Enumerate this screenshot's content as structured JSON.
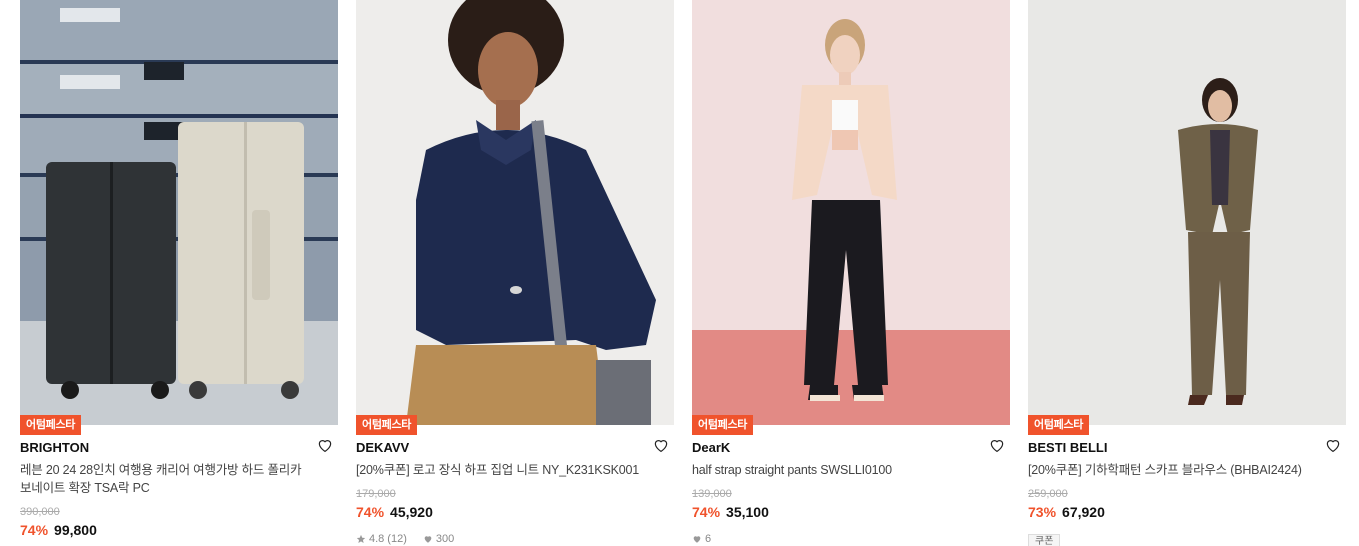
{
  "products": [
    {
      "badge": "어텀페스타",
      "brand": "BRIGHTON",
      "name": "레븐 20 24 28인치 여행용 캐리어 여행가방 하드 폴리카보네이트 확장 TSA락 PC",
      "original_price": "390,000",
      "discount": "74%",
      "price": "99,800"
    },
    {
      "badge": "어텀페스타",
      "brand": "DEKAVV",
      "name": "[20%쿠폰] 로고 장식 하프 집업 니트 NY_K231KSK001",
      "original_price": "179,000",
      "discount": "74%",
      "price": "45,920",
      "rating": "4.8",
      "review_count": "(12)",
      "likes": "300"
    },
    {
      "badge": "어텀페스타",
      "brand": "DearK",
      "name": "half strap straight pants SWSLLI0100",
      "original_price": "139,000",
      "discount": "74%",
      "price": "35,100",
      "likes": "6"
    },
    {
      "badge": "어텀페스타",
      "brand": "BESTI BELLI",
      "name": "[20%쿠폰] 기하학패턴 스카프 블라우스 (BHBAI2424)",
      "original_price": "259,000",
      "discount": "73%",
      "price": "67,920",
      "coupon_tag": "쿠폰"
    }
  ],
  "colors": {
    "accent": "#f0532c",
    "text": "#111111",
    "muted": "#aaaaaa"
  },
  "icons": {
    "like": "heart-outline-icon",
    "rating": "star-icon",
    "likes_count": "heart-filled-icon"
  }
}
